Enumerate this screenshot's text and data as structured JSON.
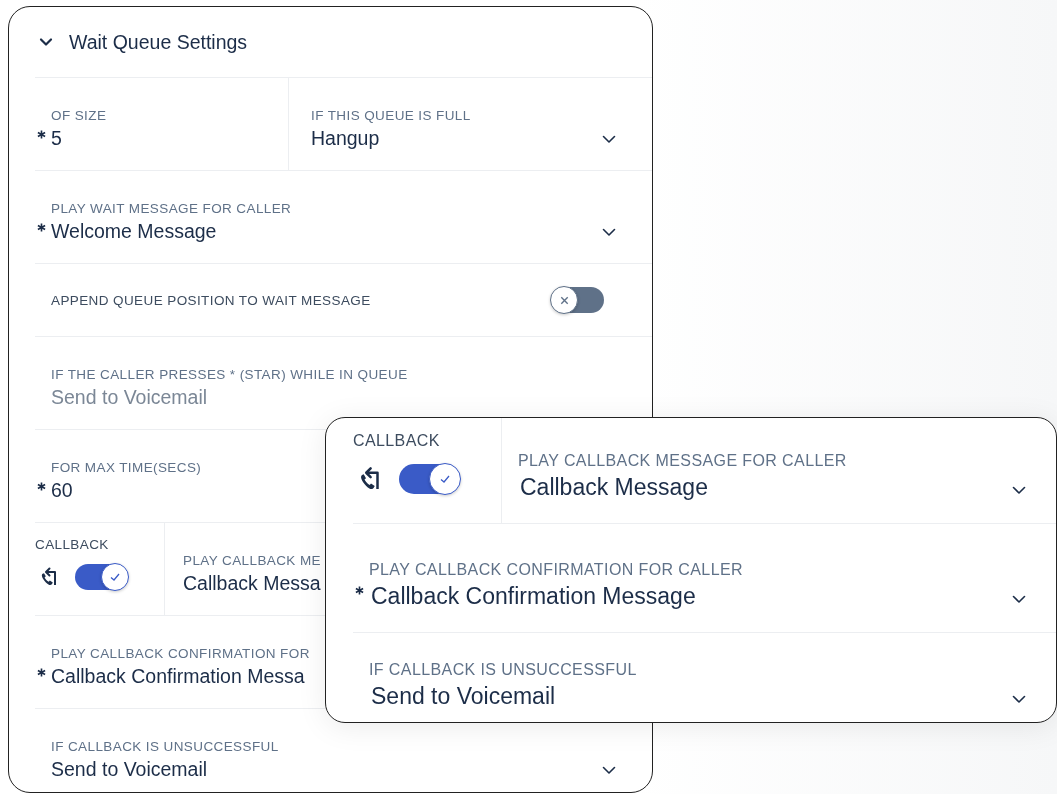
{
  "main": {
    "title": "Wait Queue Settings",
    "expanded": true,
    "rows": [
      {
        "kind": "fields",
        "fields": [
          {
            "label": "OF SIZE",
            "value": "5",
            "required": true,
            "disabled": false,
            "kind": "text"
          },
          {
            "label": "IF THIS QUEUE IS FULL",
            "value": "Hangup",
            "required": false,
            "disabled": false,
            "kind": "select"
          }
        ]
      },
      {
        "kind": "fields",
        "fields": [
          {
            "label": "PLAY WAIT MESSAGE FOR CALLER",
            "value": "Welcome Message",
            "required": true,
            "disabled": false,
            "kind": "select"
          }
        ]
      },
      {
        "kind": "toggle",
        "label": "APPEND QUEUE POSITION TO WAIT MESSAGE",
        "on": false
      },
      {
        "kind": "fields",
        "fields": [
          {
            "label": "IF THE CALLER PRESSES * (STAR) WHILE IN QUEUE",
            "value": "Send to Voicemail",
            "required": false,
            "disabled": true,
            "kind": "text"
          }
        ]
      },
      {
        "kind": "fields",
        "fields": [
          {
            "label": "FOR MAX TIME(SECS)",
            "value": "60",
            "required": true,
            "disabled": false,
            "kind": "text"
          }
        ]
      },
      {
        "kind": "callback",
        "label": "CALLBACK",
        "on": true,
        "field": {
          "label": "PLAY CALLBACK ME",
          "value": "Callback Messa",
          "disabled": false
        }
      },
      {
        "kind": "fields",
        "fields": [
          {
            "label": "PLAY CALLBACK CONFIRMATION FOR",
            "value": "Callback Confirmation Messa",
            "required": true,
            "disabled": false,
            "kind": "text"
          }
        ]
      },
      {
        "kind": "fields",
        "fields": [
          {
            "label": "IF CALLBACK IS UNSUCCESSFUL",
            "value": "Send to Voicemail",
            "required": false,
            "disabled": false,
            "kind": "select"
          }
        ]
      }
    ]
  },
  "zoom": {
    "rows": [
      {
        "kind": "callback",
        "label": "CALLBACK",
        "on": true,
        "field": {
          "label": "PLAY CALLBACK MESSAGE FOR CALLER",
          "value": "Callback Message",
          "disabled": false,
          "kind": "select"
        }
      },
      {
        "kind": "fields",
        "fields": [
          {
            "label": "PLAY CALLBACK CONFIRMATION FOR CALLER",
            "value": "Callback Confirmation Message",
            "required": true,
            "disabled": false,
            "kind": "select"
          }
        ]
      },
      {
        "kind": "fields",
        "fields": [
          {
            "label": "IF CALLBACK IS UNSUCCESSFUL",
            "value": "Send to Voicemail",
            "required": false,
            "disabled": false,
            "kind": "select"
          }
        ]
      }
    ]
  }
}
